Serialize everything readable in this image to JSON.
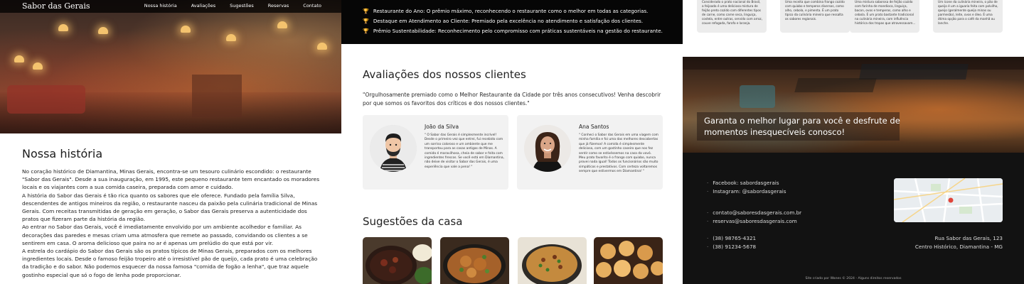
{
  "nav": {
    "brand": "Sabor das Gerais",
    "links": [
      "Nossa história",
      "Avaliações",
      "Sugestões",
      "Reservas",
      "Contato"
    ]
  },
  "story": {
    "title": "Nossa história",
    "paragraphs": [
      " No coração histórico de Diamantina, Minas Gerais, encontra-se um tesouro culinário escondido: o restaurante \"Sabor das Gerais\". Desde a sua inauguração, em 1995, este pequeno restaurante tem encantado os moradores locais e os viajantes com a sua comida caseira, preparada com amor e cuidado.",
      "A história do Sabor das Gerais é tão rica quanto os sabores que ele oferece. Fundado pela família Silva, descendentes de antigos mineiros da região, o restaurante nasceu da paixão pela culinária tradicional de Minas Gerais. Com receitas transmitidas de geração em geração, o Sabor das Gerais preserva a autenticidade dos pratos que fizeram parte da história da região.",
      "Ao entrar no Sabor das Gerais, você é imediatamente envolvido por um ambiente acolhedor e familiar. As decorações das paredes e mesas criam uma atmosfera que remete ao passado, convidando os clientes a se sentirem em casa. O aroma delicioso que paira no ar é apenas um prelúdio do que está por vir.",
      "A estrela do cardápio do Sabor das Gerais são os pratos típicos de Minas Gerais, preparados com os melhores ingredientes locais. Desde o famoso feijão tropeiro até o irresistível pão de queijo, cada prato é uma celebração da tradição e do sabor. Não podemos esquecer da nossa famosa \"comida de fogão a lenha\", que traz aquele gostinho especial que só o fogo de lenha pode proporcionar."
    ]
  },
  "awards": [
    "Restaurante do Ano: O prêmio máximo, reconhecendo o restaurante como o melhor em todas as categorias.",
    "Destaque em Atendimento ao Cliente: Premiado pela excelência no atendimento e satisfação dos clientes.",
    "Prêmio Sustentabilidade: Reconhecimento pelo compromisso com práticas sustentáveis na gestão do restaurante."
  ],
  "reviews": {
    "title": "Avaliações dos nossos clientes",
    "quote": "\"Orgulhosamente premiado como o Melhor Restaurante da Cidade por três anos consecutivos! Venha descobrir por que somos os favoritos dos críticos e dos nossos clientes.\"",
    "items": [
      {
        "name": "João da Silva",
        "text": "\" O Sabor das Gerais é simplesmente incrível! Desde o primeiro vez que entrei, fui recebido com um sorriso caloroso e um ambiente que me transportou para as casas antigas de Minas. A comida é maravilhosa, cheia de sabor e feita com ingredientes frescos. Se você está em Diamantina, não deixe de visitar o Sabor das Gerais, é uma experiência que vale a pena! \""
      },
      {
        "name": "Ana Santos",
        "text": "\" Conheci o Sabor das Gerais em uma viagem com minha família e foi uma das melhores descobertas que já fizemos! A comida é simplesmente deliciosa, com um gostinho caseiro que nos fez sentir como se estivéssemos na casa da vovó. Meu prato favorito é o frango com quiabo, nunca provei nada igual! Todos os funcionários são muito simpáticos e prestativos. Com certeza voltaremos sempre que estivermos em Diamantina! \""
      }
    ]
  },
  "suggestions": {
    "title": "Sugestões da casa"
  },
  "tips": [
    "Considerado o prato nacional do Brasil, a feijoada é uma deliciosa mistura de feijão preto cozido com diferentes tipos de carne, como carne seca, linguiça, costela, entre outras, servido com arroz, couve refogada, farofa e laranja.",
    "Uma receita que combina frango cozido com quiabo e temperos diversos, como alho, cebola, e pimenta. É um prato típico da culinária mineira que ressalta os sabores regionais.",
    "Uma mistura saborosa de feijão cozido com farinha de mandioca, linguiça, bacon, ovos e temperos, como alho e cebola. É um prato bastante tradicional na culinária mineira, com influência histórica dos tropas que atravessavam...",
    "Um ícone da culinária mineira, o pão de queijo é um a iguaria feita com polvilho, queijo (geralmente queijo minas ou parmesão), leite, ovos e óleo. É uma ótima opção para o café da manhã ou lanche."
  ],
  "reservation_banner": "Garanta o melhor lugar para você e desfrute de momentos inesquecíveis conosco!",
  "footer": {
    "social": [
      "Facebook: sabordasgerais",
      "Instagram: @sabordasgerais"
    ],
    "emails": [
      "contato@saboresdasgerais.com.br",
      "reservas@saboresdasgerais.com"
    ],
    "phones": [
      "(38) 98765-4321",
      "(38) 91234-5678"
    ],
    "address": [
      "Rua Sabor das Gerais, 123",
      "Centro Histórico, Diamantina - MG"
    ],
    "credit": "Site criado por Wanes © 2024 - Alguns direitos reservados"
  },
  "colors": {
    "accent_trophy": "#e3b54a",
    "footer_bg": "#121212",
    "awards_bg": "#060606"
  }
}
